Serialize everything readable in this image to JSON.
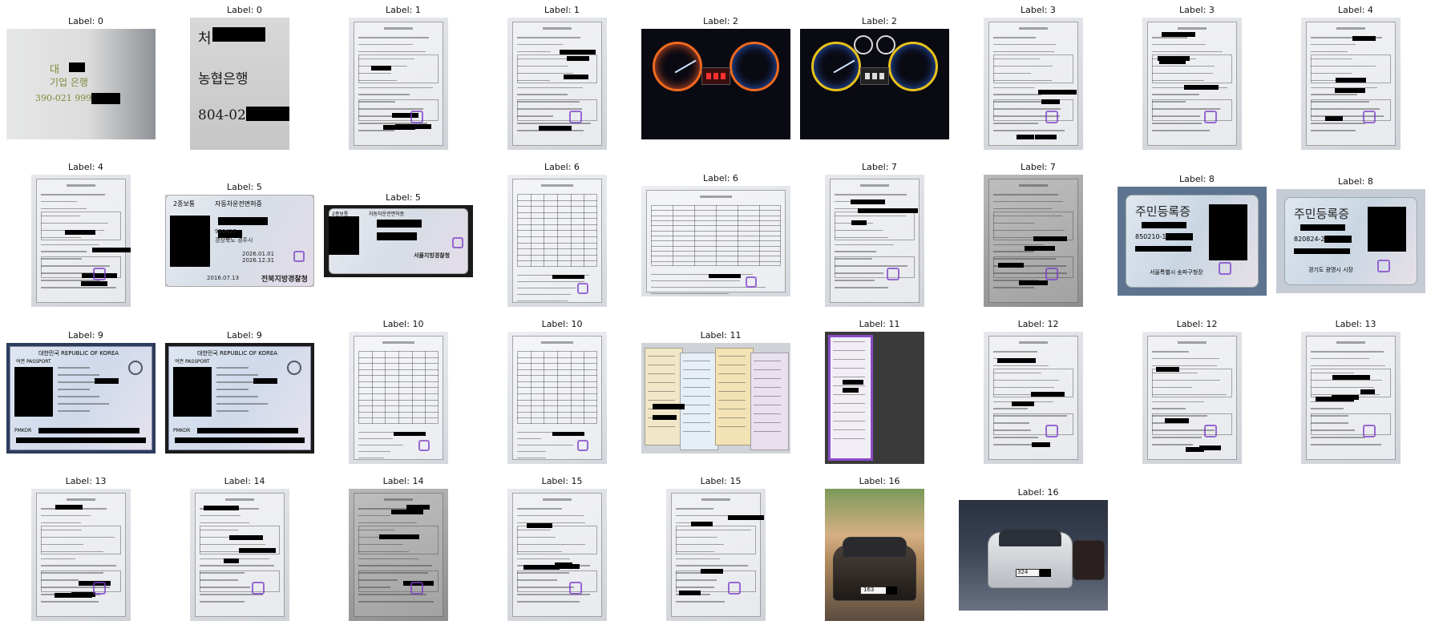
{
  "label_prefix": "Label: ",
  "cells": [
    {
      "label": "0",
      "kind": "handwritten-note",
      "texts": [
        "대",
        "기업 은행",
        "390-021 999-"
      ]
    },
    {
      "label": "0",
      "kind": "handwritten-note",
      "texts": [
        "처",
        "농협은행",
        "804-02-"
      ]
    },
    {
      "label": "1",
      "kind": "document-form"
    },
    {
      "label": "1",
      "kind": "document-form"
    },
    {
      "label": "2",
      "kind": "dashboard-orange"
    },
    {
      "label": "2",
      "kind": "dashboard-yellow"
    },
    {
      "label": "3",
      "kind": "document-form"
    },
    {
      "label": "3",
      "kind": "document-form"
    },
    {
      "label": "4",
      "kind": "document-form"
    },
    {
      "label": "4",
      "kind": "document-form"
    },
    {
      "label": "5",
      "kind": "license-card",
      "texts": [
        "2종보통",
        "자동차운전면허증",
        "950417-",
        "경상북도 경주시",
        "2026.01.01",
        "2026.12.31",
        "2016.07.13",
        "전북지방경찰청"
      ]
    },
    {
      "label": "5",
      "kind": "license-card",
      "texts": [
        "2종보통",
        "자동차운전면허증",
        "서울지방경찰청"
      ]
    },
    {
      "label": "6",
      "kind": "document-table"
    },
    {
      "label": "6",
      "kind": "document-table"
    },
    {
      "label": "7",
      "kind": "document-form"
    },
    {
      "label": "7",
      "kind": "document-form-dark"
    },
    {
      "label": "8",
      "kind": "id-card",
      "texts": [
        "주민등록증",
        "850210-1",
        "서울특별시 송파구청장"
      ]
    },
    {
      "label": "8",
      "kind": "id-card",
      "texts": [
        "주민등록증",
        "820824-2",
        "경기도 광명시 시장"
      ]
    },
    {
      "label": "9",
      "kind": "passport",
      "texts": [
        "대한민국 REPUBLIC OF KOREA",
        "여권 PASSPORT",
        "PMKOR"
      ]
    },
    {
      "label": "9",
      "kind": "passport",
      "texts": [
        "대한민국 REPUBLIC OF KOREA",
        "여권 PASSPORT",
        "PMKOR"
      ]
    },
    {
      "label": "10",
      "kind": "document-table"
    },
    {
      "label": "10",
      "kind": "document-table"
    },
    {
      "label": "11",
      "kind": "receipts"
    },
    {
      "label": "11",
      "kind": "receipt-dark"
    },
    {
      "label": "12",
      "kind": "document-form"
    },
    {
      "label": "12",
      "kind": "document-form"
    },
    {
      "label": "13",
      "kind": "document-form"
    },
    {
      "label": "13",
      "kind": "document-form"
    },
    {
      "label": "14",
      "kind": "document-form"
    },
    {
      "label": "14",
      "kind": "document-form-dark"
    },
    {
      "label": "15",
      "kind": "document-form"
    },
    {
      "label": "15",
      "kind": "document-form"
    },
    {
      "label": "16",
      "kind": "car-photo",
      "texts": [
        "163"
      ]
    },
    {
      "label": "16",
      "kind": "car-photo-garage",
      "texts": [
        "324"
      ]
    }
  ]
}
